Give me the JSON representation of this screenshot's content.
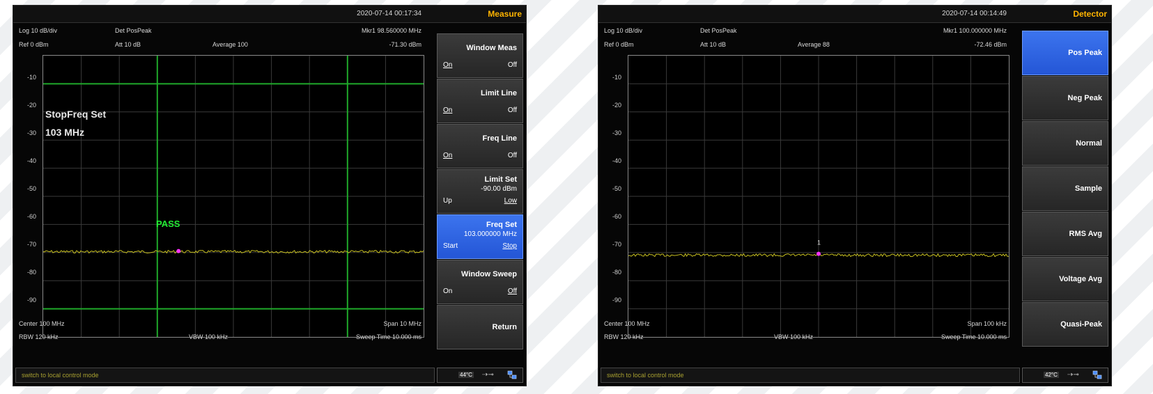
{
  "panels": [
    {
      "timestamp": "2020-07-14 00:17:34",
      "menu_title": "Measure",
      "header": {
        "scale": "Log 10 dB/div",
        "det": "Det PosPeak",
        "marker": "Mkr1  98.560000 MHz",
        "ref": "Ref 0 dBm",
        "att": "Att 10 dB",
        "average": "Average 100",
        "marker_level": "-71.30 dBm"
      },
      "y_labels": [
        "-10",
        "-20",
        "-30",
        "-40",
        "-50",
        "-60",
        "-70",
        "-80",
        "-90"
      ],
      "overlay": {
        "line1": "StopFreq Set",
        "line2": "103 MHz",
        "pass": "PASS"
      },
      "footer": {
        "center": "Center 100 MHz",
        "span": "Span 10 MHz",
        "rbw": "RBW 120 kHz",
        "vbw": "VBW 100 kHz",
        "sweep": "Sweep Time 10.000 ms"
      },
      "status": "switch to local control mode",
      "temperature": "44°C",
      "softkeys": [
        {
          "title": "Window Meas",
          "left": "On",
          "right": "Off"
        },
        {
          "title": "Limit Line",
          "left": "On",
          "right": "Off"
        },
        {
          "title": "Freq Line",
          "left": "On",
          "right": "Off"
        },
        {
          "title": "Limit Set",
          "sub": "-90.00 dBm",
          "left": "Up",
          "right": "Low"
        },
        {
          "title": "Freq Set",
          "sub": "103.000000 MHz",
          "left": "Start",
          "right": "Stop"
        },
        {
          "title": "Window Sweep",
          "left": "On",
          "right": "Off"
        },
        {
          "title": "Return"
        }
      ]
    },
    {
      "timestamp": "2020-07-14 00:14:49",
      "menu_title": "Detector",
      "header": {
        "scale": "Log 10 dB/div",
        "det": "Det PosPeak",
        "marker": "Mkr1  100.000000 MHz",
        "ref": "Ref 0 dBm",
        "att": "Att 10 dB",
        "average": "Average 88",
        "marker_level": "-72.46 dBm"
      },
      "y_labels": [
        "-10",
        "-20",
        "-30",
        "-40",
        "-50",
        "-60",
        "-70",
        "-80",
        "-90"
      ],
      "marker_label": "1",
      "footer": {
        "center": "Center 100 MHz",
        "span": "Span 100 kHz",
        "rbw": "RBW 120 kHz",
        "vbw": "VBW 100 kHz",
        "sweep": "Sweep Time 10.000 ms"
      },
      "status": "switch to local control mode",
      "temperature": "42°C",
      "softkeys": [
        {
          "title": "Pos Peak"
        },
        {
          "title": "Neg Peak"
        },
        {
          "title": "Normal"
        },
        {
          "title": "Sample"
        },
        {
          "title": "RMS Avg"
        },
        {
          "title": "Voltage Avg"
        },
        {
          "title": "Quasi-Peak"
        }
      ]
    }
  ],
  "colors": {
    "trace": "#c8c020",
    "limit_line": "#1faa2a",
    "marker": "#ff33ff",
    "grid": "#3a3a3a",
    "active_key": "#2f67e6",
    "menu_title": "#ffb400"
  },
  "icons": [
    "usb-icon",
    "network-icon"
  ]
}
